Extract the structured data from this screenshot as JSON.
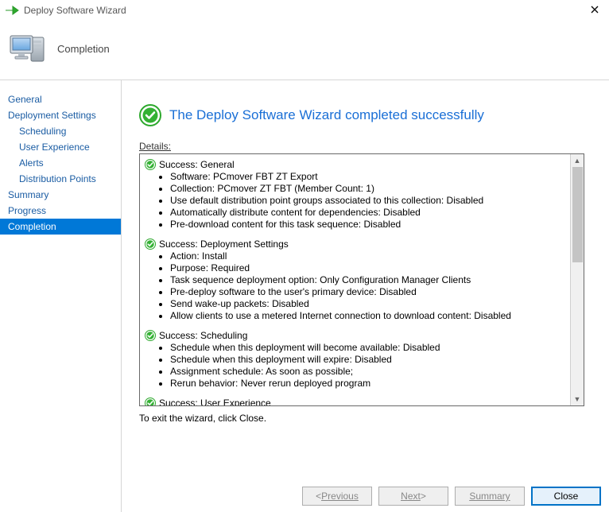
{
  "window": {
    "title": "Deploy Software Wizard",
    "heading": "Completion"
  },
  "nav": {
    "items": [
      {
        "label": "General",
        "indent": 0,
        "selected": false
      },
      {
        "label": "Deployment Settings",
        "indent": 0,
        "selected": false
      },
      {
        "label": "Scheduling",
        "indent": 1,
        "selected": false
      },
      {
        "label": "User Experience",
        "indent": 1,
        "selected": false
      },
      {
        "label": "Alerts",
        "indent": 1,
        "selected": false
      },
      {
        "label": "Distribution Points",
        "indent": 1,
        "selected": false
      },
      {
        "label": "Summary",
        "indent": 0,
        "selected": false
      },
      {
        "label": "Progress",
        "indent": 0,
        "selected": false
      },
      {
        "label": "Completion",
        "indent": 0,
        "selected": true
      }
    ]
  },
  "main": {
    "success_message": "The Deploy Software Wizard completed successfully",
    "details_label": "Details:",
    "exit_note": "To exit the wizard, click Close."
  },
  "details": [
    {
      "title": "Success: General",
      "items": [
        "Software: PCmover FBT ZT Export",
        "Collection: PCmover ZT FBT (Member Count: 1)",
        "Use default distribution point groups associated to this collection: Disabled",
        "Automatically distribute content for dependencies: Disabled",
        "Pre-download content for this task sequence: Disabled"
      ]
    },
    {
      "title": "Success: Deployment Settings",
      "items": [
        "Action: Install",
        "Purpose: Required",
        "Task sequence deployment option: Only Configuration Manager Clients",
        "Pre-deploy software to the user's primary device: Disabled",
        "Send wake-up packets: Disabled",
        "Allow clients to use a metered Internet connection to download content: Disabled"
      ]
    },
    {
      "title": "Success: Scheduling",
      "items": [
        "Schedule when this deployment will become available: Disabled",
        "Schedule when this deployment will expire: Disabled",
        "Assignment schedule: As soon as possible;",
        "Rerun behavior: Never rerun deployed program"
      ]
    },
    {
      "title": "Success: User Experience",
      "items": []
    }
  ],
  "buttons": {
    "previous": "Previous",
    "next": "Next",
    "summary": "Summary",
    "close": "Close"
  }
}
